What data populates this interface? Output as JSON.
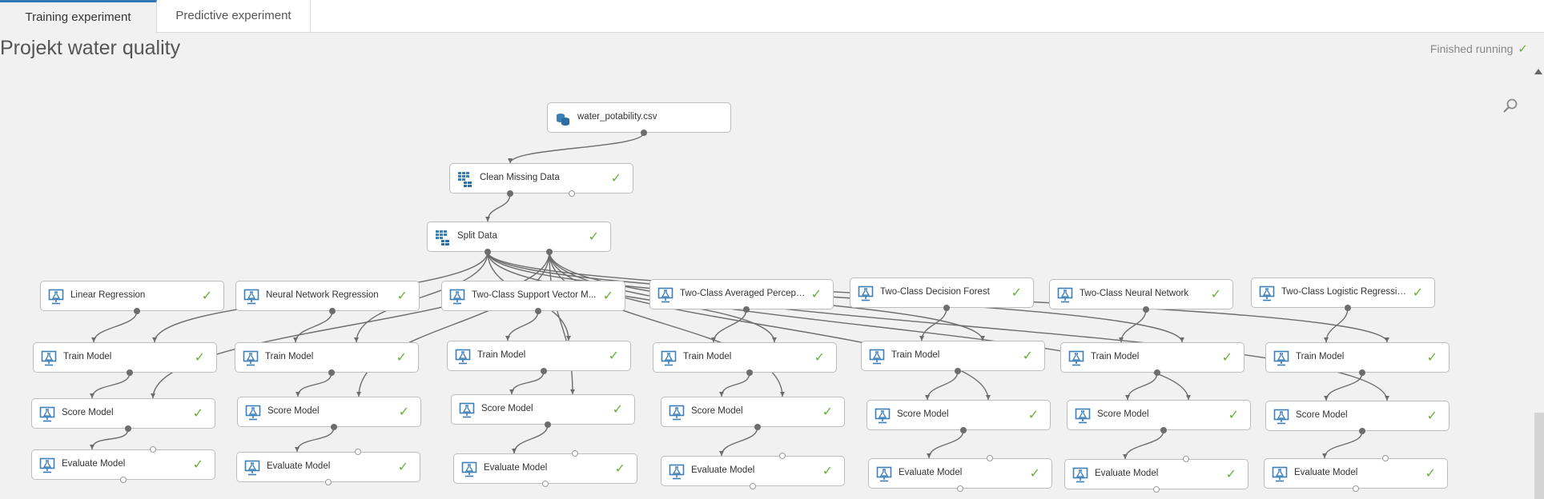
{
  "tabs": [
    {
      "label": "Training experiment",
      "active": true
    },
    {
      "label": "Predictive experiment",
      "active": false
    }
  ],
  "experiment": {
    "title": "Projekt water quality",
    "status": "Finished running",
    "status_icon": "check-icon"
  },
  "colors": {
    "accent": "#3277b6",
    "success": "#68b13c",
    "edge": "#6d6d6d",
    "icon": "#3a7fb8"
  },
  "modules": [
    {
      "id": "dataset",
      "label": "water_potability.csv",
      "icon": "dataset-icon",
      "complete": false
    },
    {
      "id": "clean",
      "label": "Clean Missing Data",
      "icon": "data-transform-icon",
      "complete": true
    },
    {
      "id": "split",
      "label": "Split Data",
      "icon": "data-transform-icon",
      "complete": true
    },
    {
      "id": "linreg",
      "label": "Linear Regression",
      "icon": "model-icon",
      "complete": true
    },
    {
      "id": "nnreg",
      "label": "Neural Network Regression",
      "icon": "model-icon",
      "complete": true
    },
    {
      "id": "svm",
      "label": "Two-Class Support Vector M...",
      "icon": "model-icon",
      "complete": true
    },
    {
      "id": "avgperc",
      "label": "Two-Class Averaged Percept...",
      "icon": "model-icon",
      "complete": true
    },
    {
      "id": "dforest",
      "label": "Two-Class Decision Forest",
      "icon": "model-icon",
      "complete": true
    },
    {
      "id": "nn",
      "label": "Two-Class Neural Network",
      "icon": "model-icon",
      "complete": true
    },
    {
      "id": "logreg",
      "label": "Two-Class Logistic Regression",
      "icon": "model-icon",
      "complete": true
    },
    {
      "id": "train1",
      "label": "Train Model",
      "icon": "model-icon",
      "complete": true
    },
    {
      "id": "train2",
      "label": "Train Model",
      "icon": "model-icon",
      "complete": true
    },
    {
      "id": "train3",
      "label": "Train Model",
      "icon": "model-icon",
      "complete": true
    },
    {
      "id": "train4",
      "label": "Train Model",
      "icon": "model-icon",
      "complete": true
    },
    {
      "id": "train5",
      "label": "Train Model",
      "icon": "model-icon",
      "complete": true
    },
    {
      "id": "train6",
      "label": "Train Model",
      "icon": "model-icon",
      "complete": true
    },
    {
      "id": "train7",
      "label": "Train Model",
      "icon": "model-icon",
      "complete": true
    },
    {
      "id": "score1",
      "label": "Score Model",
      "icon": "model-icon",
      "complete": true
    },
    {
      "id": "score2",
      "label": "Score Model",
      "icon": "model-icon",
      "complete": true
    },
    {
      "id": "score3",
      "label": "Score Model",
      "icon": "model-icon",
      "complete": true
    },
    {
      "id": "score4",
      "label": "Score Model",
      "icon": "model-icon",
      "complete": true
    },
    {
      "id": "score5",
      "label": "Score Model",
      "icon": "model-icon",
      "complete": true
    },
    {
      "id": "score6",
      "label": "Score Model",
      "icon": "model-icon",
      "complete": true
    },
    {
      "id": "score7",
      "label": "Score Model",
      "icon": "model-icon",
      "complete": true
    },
    {
      "id": "eval1",
      "label": "Evaluate Model",
      "icon": "model-icon",
      "complete": true
    },
    {
      "id": "eval2",
      "label": "Evaluate Model",
      "icon": "model-icon",
      "complete": true
    },
    {
      "id": "eval3",
      "label": "Evaluate Model",
      "icon": "model-icon",
      "complete": true
    },
    {
      "id": "eval4",
      "label": "Evaluate Model",
      "icon": "model-icon",
      "complete": true
    },
    {
      "id": "eval5",
      "label": "Evaluate Model",
      "icon": "model-icon",
      "complete": true
    },
    {
      "id": "eval6",
      "label": "Evaluate Model",
      "icon": "model-icon",
      "complete": true
    },
    {
      "id": "eval7",
      "label": "Evaluate Model",
      "icon": "model-icon",
      "complete": true
    }
  ],
  "connections": [
    [
      "dataset",
      "clean"
    ],
    [
      "clean",
      "split"
    ],
    [
      "split",
      "train1"
    ],
    [
      "split",
      "train2"
    ],
    [
      "split",
      "train3"
    ],
    [
      "split",
      "train4"
    ],
    [
      "split",
      "train5"
    ],
    [
      "split",
      "train6"
    ],
    [
      "split",
      "train7"
    ],
    [
      "split",
      "score1"
    ],
    [
      "split",
      "score2"
    ],
    [
      "split",
      "score3"
    ],
    [
      "split",
      "score4"
    ],
    [
      "split",
      "score5"
    ],
    [
      "split",
      "score6"
    ],
    [
      "split",
      "score7"
    ],
    [
      "linreg",
      "train1"
    ],
    [
      "nnreg",
      "train2"
    ],
    [
      "svm",
      "train3"
    ],
    [
      "avgperc",
      "train4"
    ],
    [
      "dforest",
      "train5"
    ],
    [
      "nn",
      "train6"
    ],
    [
      "logreg",
      "train7"
    ],
    [
      "train1",
      "score1"
    ],
    [
      "train2",
      "score2"
    ],
    [
      "train3",
      "score3"
    ],
    [
      "train4",
      "score4"
    ],
    [
      "train5",
      "score5"
    ],
    [
      "train6",
      "score6"
    ],
    [
      "train7",
      "score7"
    ],
    [
      "score1",
      "eval1"
    ],
    [
      "score2",
      "eval2"
    ],
    [
      "score3",
      "eval3"
    ],
    [
      "score4",
      "eval4"
    ],
    [
      "score5",
      "eval5"
    ],
    [
      "score6",
      "eval6"
    ],
    [
      "score7",
      "eval7"
    ]
  ]
}
